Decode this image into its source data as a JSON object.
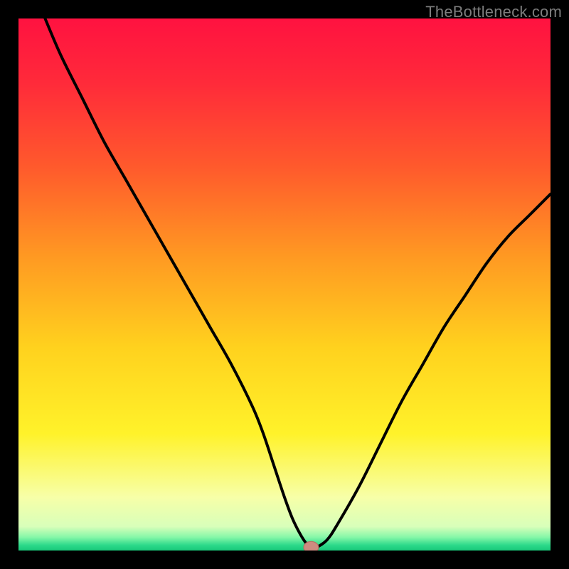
{
  "watermark": "TheBottleneck.com",
  "colors": {
    "background": "#000000",
    "gradient_stops": [
      {
        "offset": 0.0,
        "color": "#ff1240"
      },
      {
        "offset": 0.12,
        "color": "#ff2a3a"
      },
      {
        "offset": 0.28,
        "color": "#ff5a2c"
      },
      {
        "offset": 0.45,
        "color": "#ff9a22"
      },
      {
        "offset": 0.62,
        "color": "#ffd21e"
      },
      {
        "offset": 0.78,
        "color": "#fff22a"
      },
      {
        "offset": 0.9,
        "color": "#f7ffa8"
      },
      {
        "offset": 0.955,
        "color": "#d8ffba"
      },
      {
        "offset": 0.975,
        "color": "#86f7a8"
      },
      {
        "offset": 0.99,
        "color": "#2cd98a"
      },
      {
        "offset": 1.0,
        "color": "#18c97a"
      }
    ],
    "curve": "#000000",
    "marker_fill": "#cd8b80",
    "marker_stroke": "#b76f63"
  },
  "chart_data": {
    "type": "line",
    "title": "",
    "xlabel": "",
    "ylabel": "",
    "xlim": [
      0,
      100
    ],
    "ylim": [
      0,
      100
    ],
    "grid": false,
    "series": [
      {
        "name": "curve",
        "x": [
          5,
          8,
          12,
          16,
          20,
          24,
          28,
          32,
          36,
          40,
          44,
          46,
          48,
          50,
          51.5,
          53,
          54.2,
          55,
          56,
          58,
          60,
          64,
          68,
          72,
          76,
          80,
          84,
          88,
          92,
          96,
          100
        ],
        "y": [
          100,
          93,
          85,
          77,
          70,
          63,
          56,
          49,
          42,
          35,
          27,
          22,
          16,
          10,
          6,
          3,
          1.2,
          0.6,
          0.6,
          2,
          5,
          12,
          20,
          28,
          35,
          42,
          48,
          54,
          59,
          63,
          67
        ]
      }
    ],
    "marker": {
      "x": 55,
      "y": 0.6,
      "rx": 1.4,
      "ry": 1.1
    }
  }
}
